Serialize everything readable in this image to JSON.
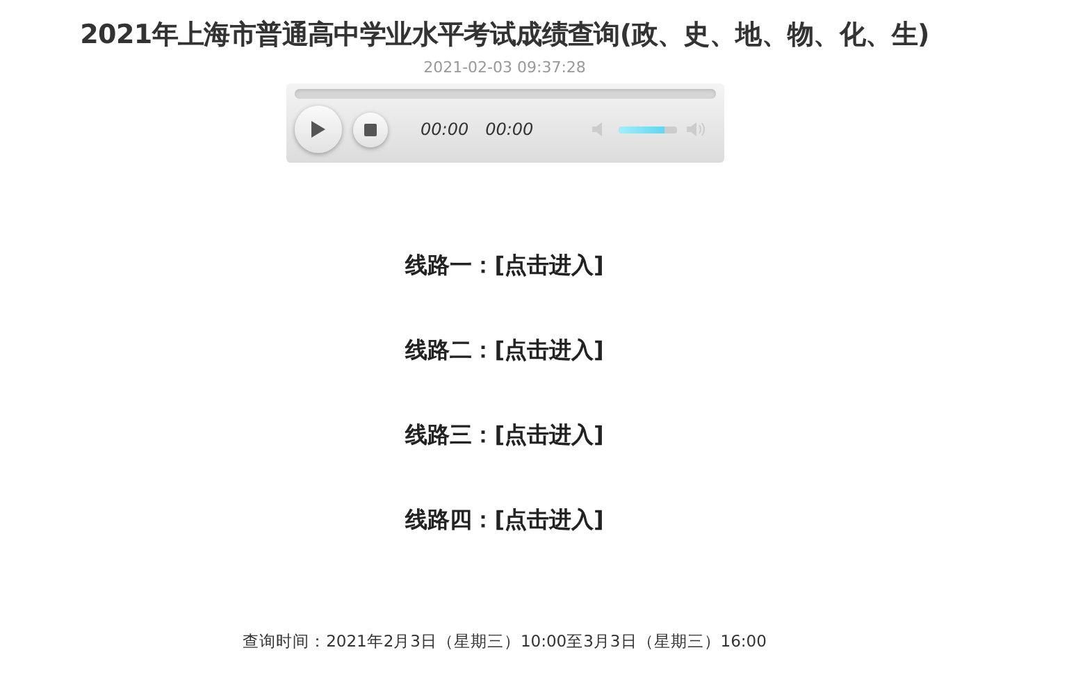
{
  "title": "2021年上海市普通高中学业水平考试成绩查询(政、史、地、物、化、生)",
  "date": "2021-02-03 09:37:28",
  "player": {
    "current_time": "00:00",
    "duration": "00:00",
    "volume": {
      "level": 0.8
    }
  },
  "routes": [
    {
      "label": "线路一：",
      "link": "[点击进入]"
    },
    {
      "label": "线路二：",
      "link": "[点击进入]"
    },
    {
      "label": "线路三：",
      "link": "[点击进入]"
    },
    {
      "label": "线路四：",
      "link": "[点击进入]"
    }
  ],
  "footer": "查询时间：2021年2月3日（星期三）10:00至3月3日（星期三）16:00"
}
